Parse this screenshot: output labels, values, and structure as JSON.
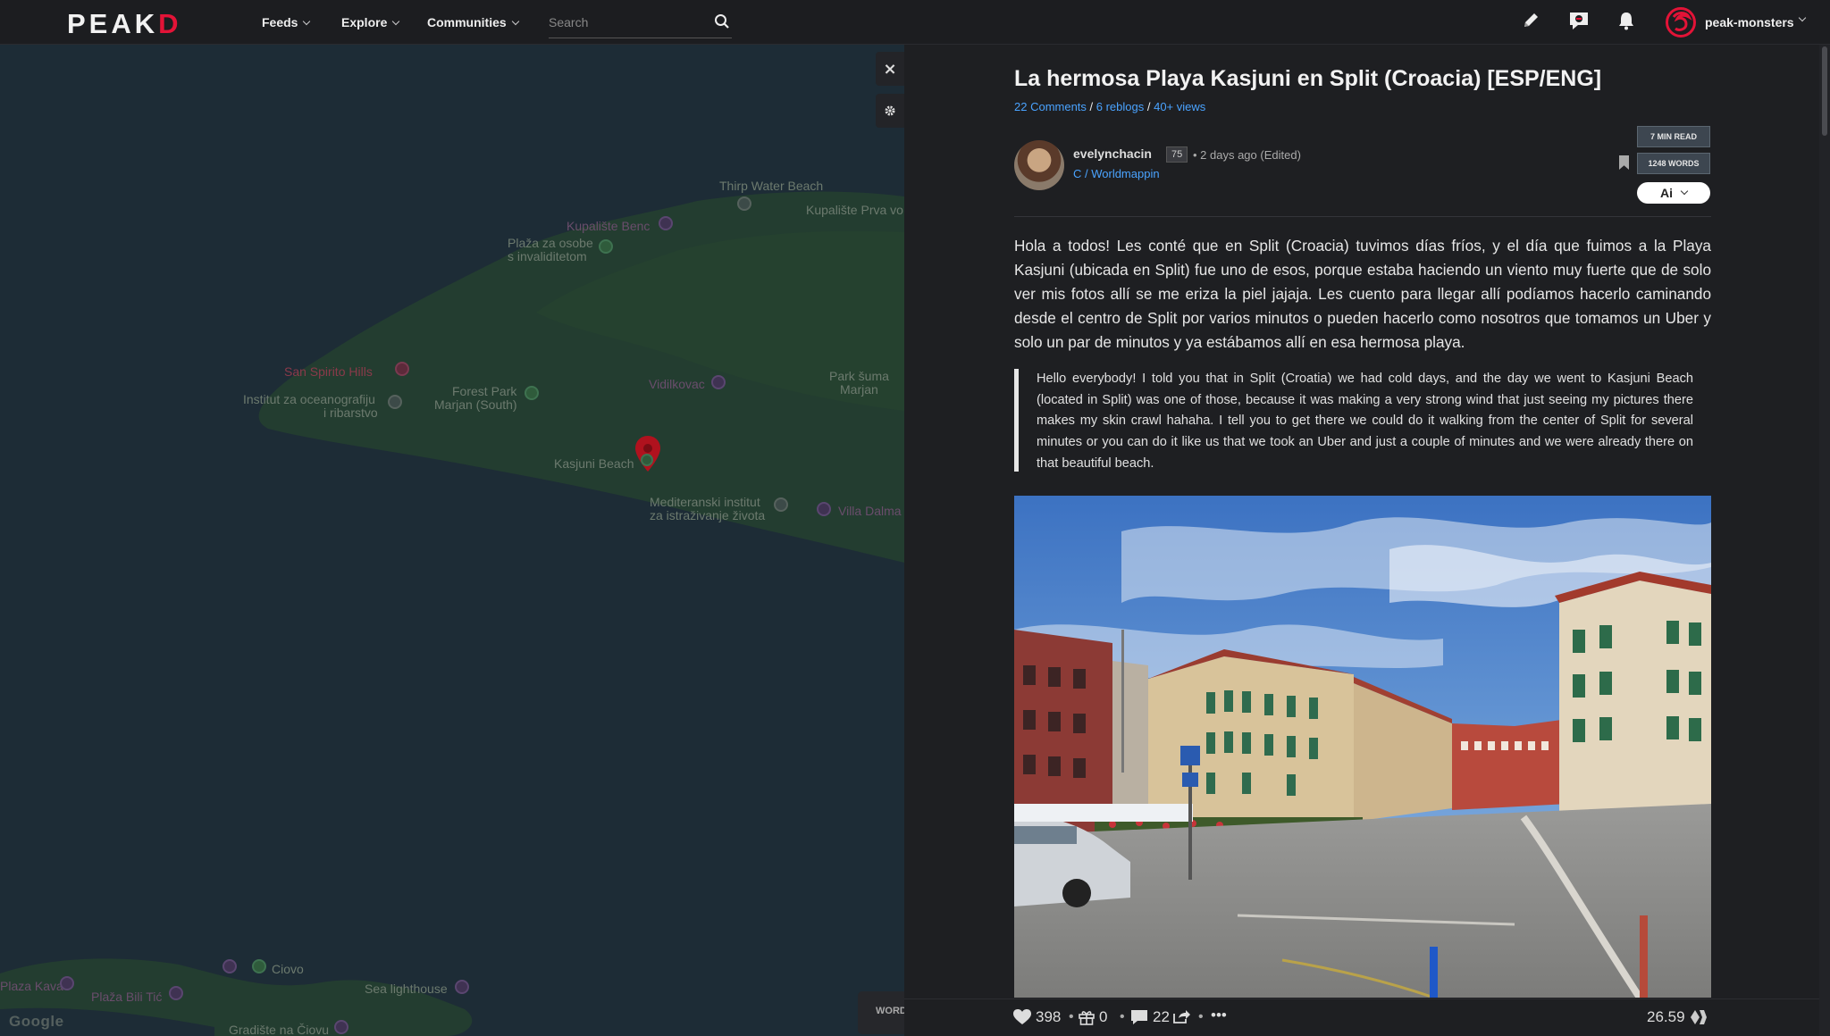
{
  "nav": {
    "logo_main": "PEAK",
    "logo_accent": "D",
    "feeds": "Feeds",
    "explore": "Explore",
    "communities": "Communities",
    "search_placeholder": "Search",
    "username": "peak-monsters"
  },
  "map": {
    "labels": {
      "thirp": "Thirp Water Beach",
      "kupaliste_benc": "Kupalište Benc",
      "kupaliste_prva": "Kupalište Prva vo",
      "plaza_osobe_1": "Plaža za osobe",
      "plaza_osobe_2": "s invaliditetom",
      "san_spirito": "San Spirito Hills",
      "forest_1": "Forest Park",
      "forest_2": "Marjan (South)",
      "institut_1": "Institut za oceanografiju",
      "institut_2": "i ribarstvo",
      "vidilkovac": "Vidilkovac",
      "park_suma_1": "Park šuma",
      "park_suma_2": "Marjan",
      "kasjuni": "Kasjuni Beach",
      "mediteranski_1": "Mediteranski institut",
      "mediteranski_2": "za istraživanje života",
      "villa": "Villa Dalma",
      "plaza_kava": "Plaza Kava",
      "plaza_bili": "Plaža Bili Tić",
      "ciovo": "Ciovo",
      "sea_lighthouse": "Sea lighthouse",
      "gradiste": "Gradište na Čiovu"
    },
    "google": "Google",
    "close_label": "×",
    "word_button": "WORD"
  },
  "article": {
    "title": "La hermosa Playa Kasjuni en Split (Croacia) [ESP/ENG]",
    "comments": "22 Comments",
    "reblogs": "6 reblogs",
    "views": "40+ views",
    "sep": " / ",
    "author": "evelynchacin",
    "reputation": "75",
    "posted": "• 2 days ago (Edited)",
    "community": "C / Worldmappin",
    "read_time": "7 MIN READ",
    "words": "1248 WORDS",
    "ai_label": "Ai",
    "body_es": "Hola a todos! Les conté que en Split (Croacia) tuvimos días fríos, y el día que fuimos a la Playa Kasjuni (ubicada en Split) fue uno de esos, porque estaba haciendo un viento muy fuerte que de solo ver mis fotos allí se me eriza la piel jajaja. Les cuento para llegar allí podíamos hacerlo caminando desde el centro de Split por varios minutos o pueden hacerlo como nosotros que tomamos un Uber y solo un par de minutos y ya estábamos allí en esa hermosa playa.",
    "body_en": "Hello everybody! I told you that in Split (Croatia) we had cold days, and the day we went to Kasjuni Beach (located in Split) was one of those, because it was making a very strong wind that just seeing my pictures there makes my skin crawl hahaha. I tell you to get there we could do it walking from the center of Split for several minutes or you can do it like us that we took an Uber and just a couple of minutes and we were already there on that beautiful beach."
  },
  "actions": {
    "votes": "398",
    "gifts": "0",
    "comments": "22",
    "payout": "26.59",
    "dot": "•",
    "more": "•••"
  }
}
